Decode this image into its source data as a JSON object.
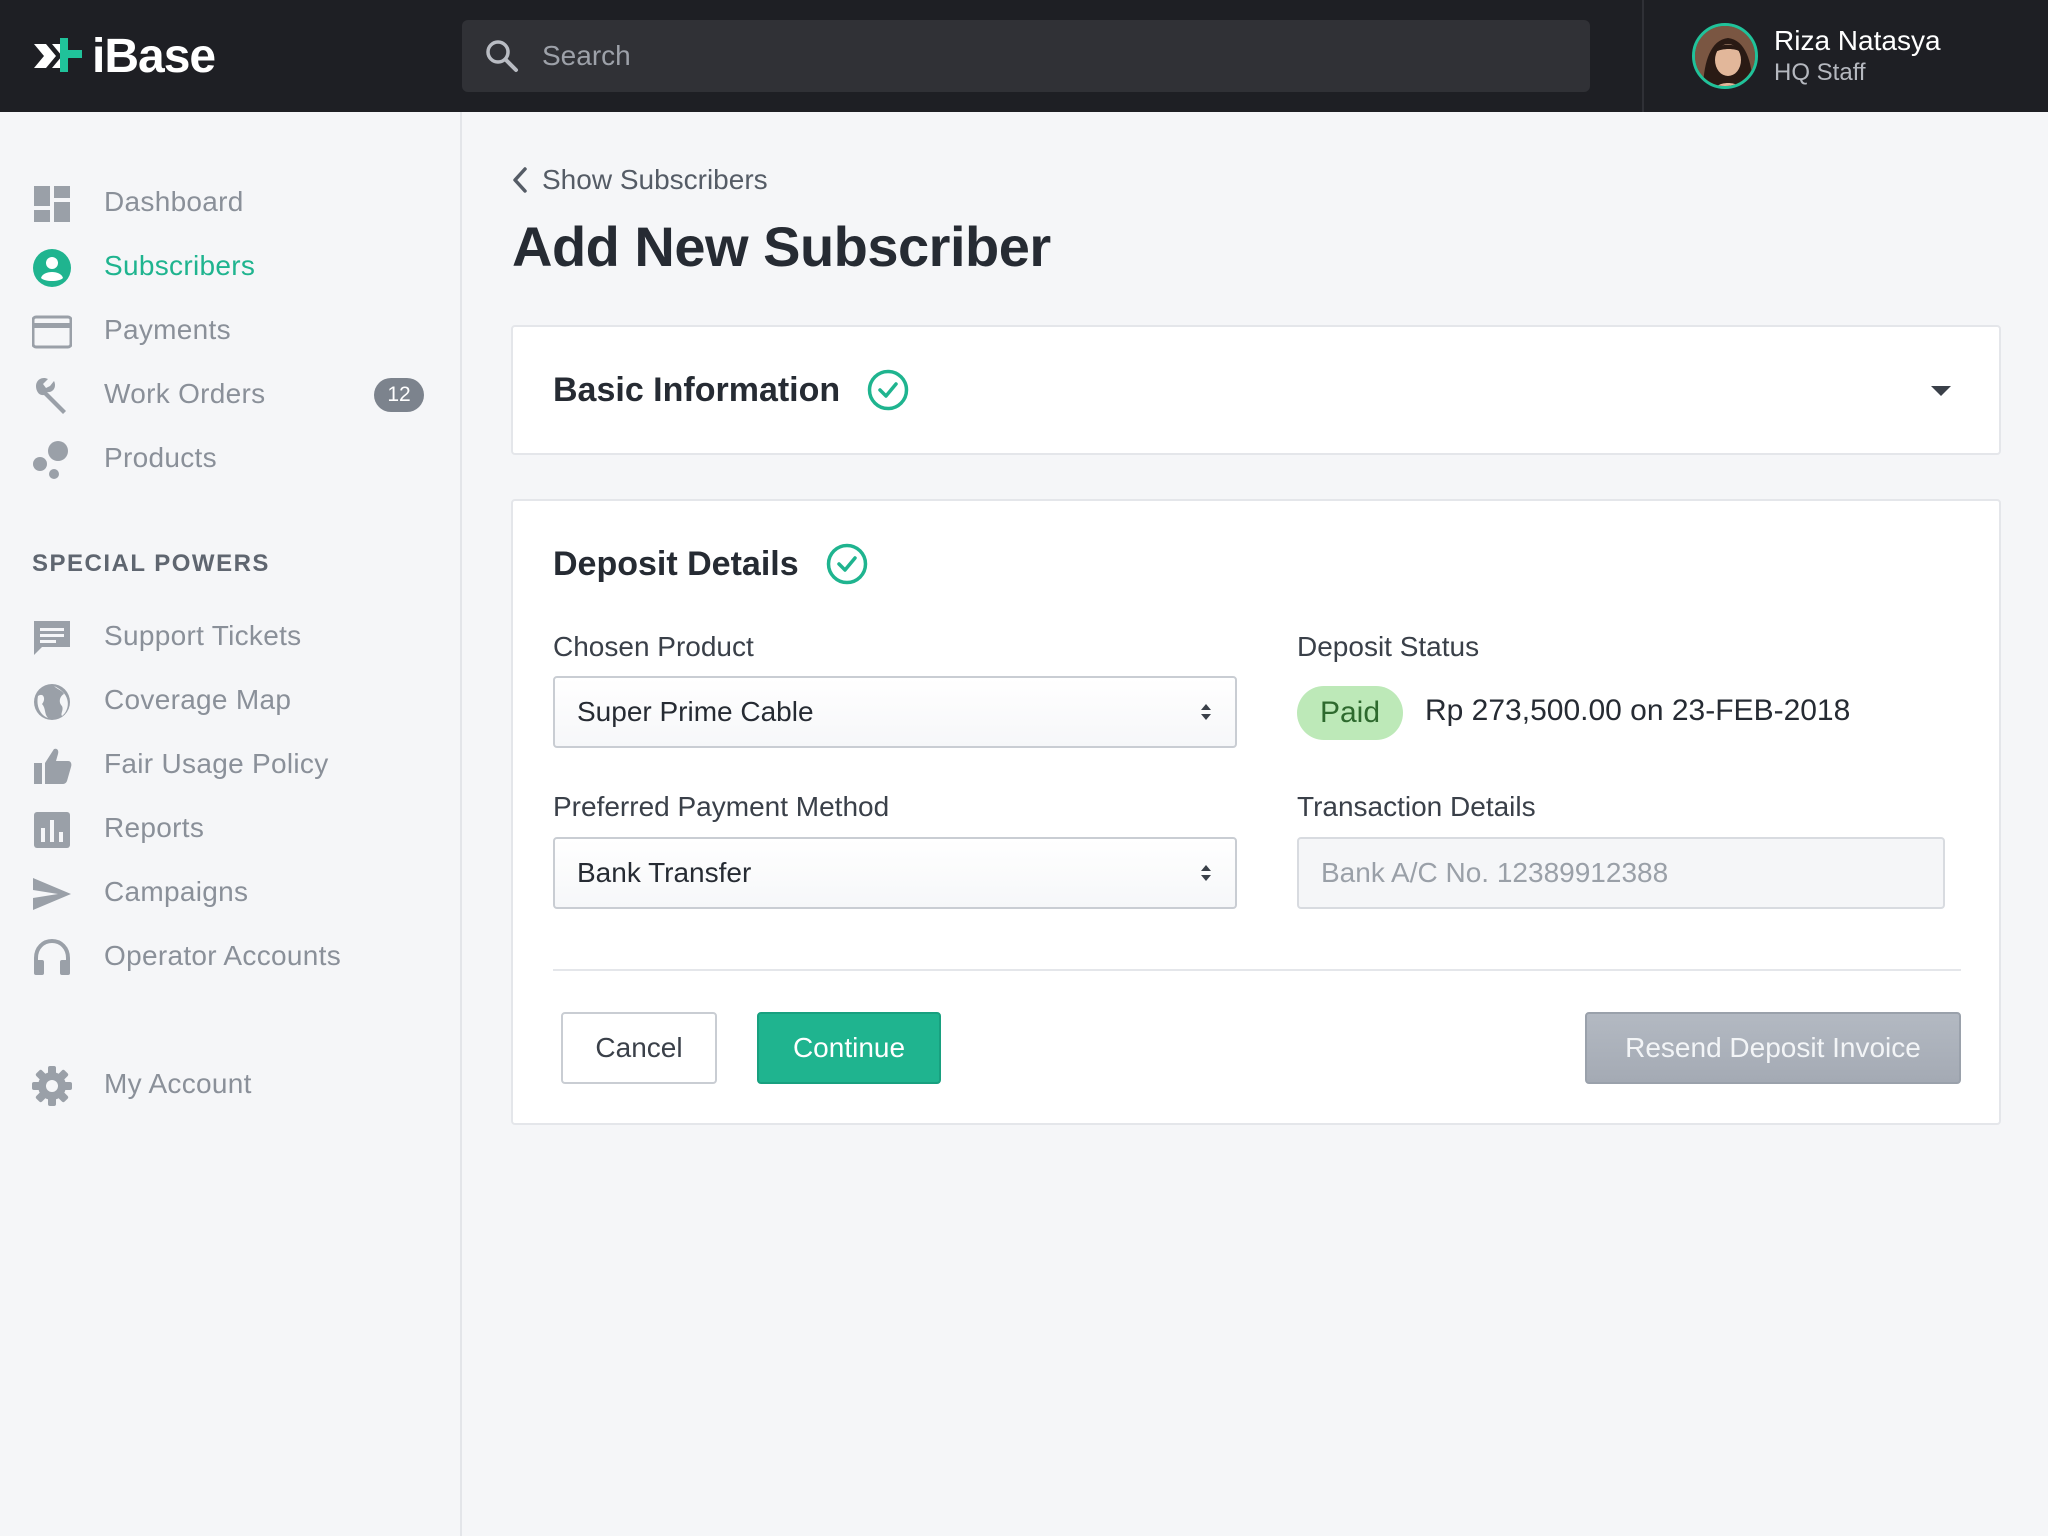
{
  "app": {
    "logo_text": "iBase"
  },
  "search": {
    "placeholder": "Search"
  },
  "user": {
    "name": "Riza Natasya",
    "role": "HQ Staff"
  },
  "sidebar": {
    "items": [
      {
        "label": "Dashboard",
        "icon": "dashboard-icon"
      },
      {
        "label": "Subscribers",
        "icon": "user-circle-icon",
        "active": true
      },
      {
        "label": "Payments",
        "icon": "credit-card-icon"
      },
      {
        "label": "Work Orders",
        "icon": "wrench-icon",
        "badge": "12"
      },
      {
        "label": "Products",
        "icon": "bubbles-icon"
      }
    ],
    "section_title": "SPECIAL POWERS",
    "special_items": [
      {
        "label": "Support Tickets",
        "icon": "chat-icon"
      },
      {
        "label": "Coverage Map",
        "icon": "globe-icon"
      },
      {
        "label": "Fair Usage Policy",
        "icon": "thumbs-up-icon"
      },
      {
        "label": "Reports",
        "icon": "bar-chart-icon"
      },
      {
        "label": "Campaigns",
        "icon": "send-icon"
      },
      {
        "label": "Operator Accounts",
        "icon": "headset-icon"
      }
    ],
    "account": {
      "label": "My Account",
      "icon": "gear-icon"
    }
  },
  "main": {
    "back_label": "Show Subscribers",
    "title": "Add New Subscriber",
    "basic_card": {
      "title": "Basic Information"
    },
    "deposit_card": {
      "title": "Deposit Details",
      "chosen_product_label": "Chosen Product",
      "chosen_product_value": "Super Prime Cable",
      "payment_method_label": "Preferred Payment Method",
      "payment_method_value": "Bank Transfer",
      "deposit_status_label": "Deposit Status",
      "deposit_status_badge": "Paid",
      "deposit_status_text": "Rp 273,500.00 on 23-FEB-2018",
      "transaction_label": "Transaction Details",
      "transaction_placeholder": "Bank A/C No. 12389912388"
    },
    "buttons": {
      "cancel": "Cancel",
      "continue": "Continue",
      "resend": "Resend Deposit Invoice"
    }
  },
  "colors": {
    "accent": "#1fb48f",
    "topbar": "#1e1f24",
    "badge_paid": "#bde9b8"
  }
}
